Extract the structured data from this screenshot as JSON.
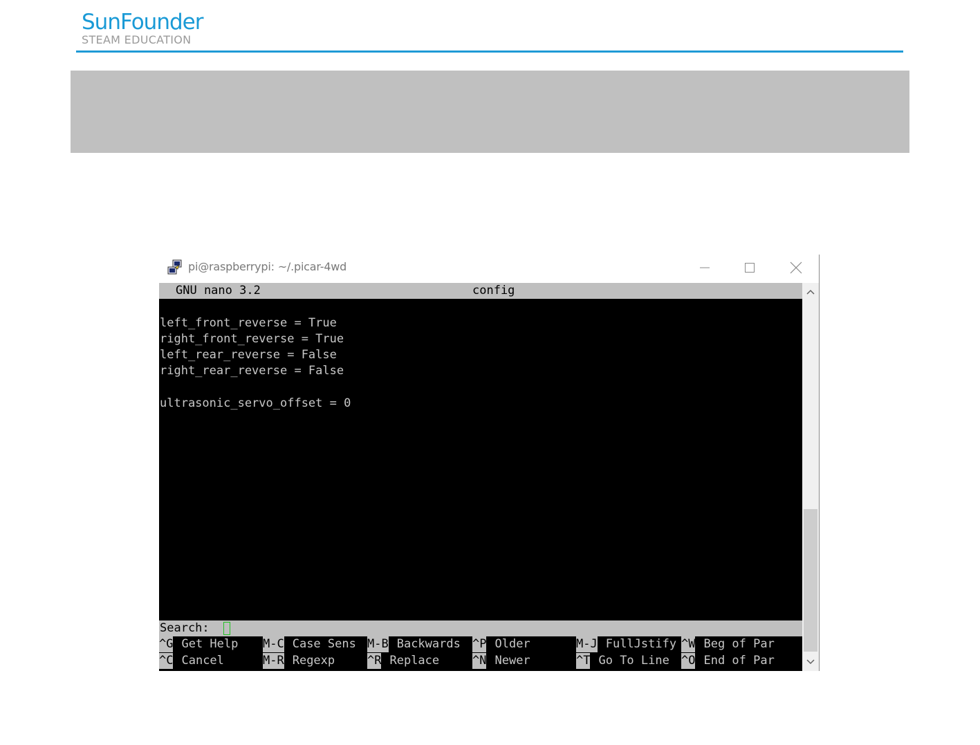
{
  "brand": {
    "name": "SunFounder",
    "tagline": "STEAM EDUCATION",
    "accent_color": "#1e9ad6"
  },
  "window": {
    "title": "pi@raspberrypi: ~/.picar-4wd",
    "icon": "putty-icon",
    "controls": [
      "minimize-icon",
      "maximize-icon",
      "close-icon"
    ]
  },
  "nano": {
    "version": "GNU nano 3.2",
    "filename": "config",
    "lines": [
      "",
      "left_front_reverse = True",
      "right_front_reverse = True",
      "left_rear_reverse = False",
      "right_rear_reverse = False",
      "",
      "ultrasonic_servo_offset = 0"
    ],
    "search_label": "Search: ",
    "shortcuts_row1": [
      {
        "key": "^G",
        "label": "Get Help"
      },
      {
        "key": "M-C",
        "label": "Case Sens"
      },
      {
        "key": "M-B",
        "label": "Backwards"
      },
      {
        "key": "^P",
        "label": "Older"
      },
      {
        "key": "M-J",
        "label": "FullJstify"
      },
      {
        "key": "^W",
        "label": "Beg of Par"
      }
    ],
    "shortcuts_row2": [
      {
        "key": "^C",
        "label": "Cancel"
      },
      {
        "key": "M-R",
        "label": "Regexp"
      },
      {
        "key": "^R",
        "label": "Replace"
      },
      {
        "key": "^N",
        "label": "Newer"
      },
      {
        "key": "^T",
        "label": "Go To Line"
      },
      {
        "key": "^O",
        "label": "End of Par"
      }
    ]
  }
}
